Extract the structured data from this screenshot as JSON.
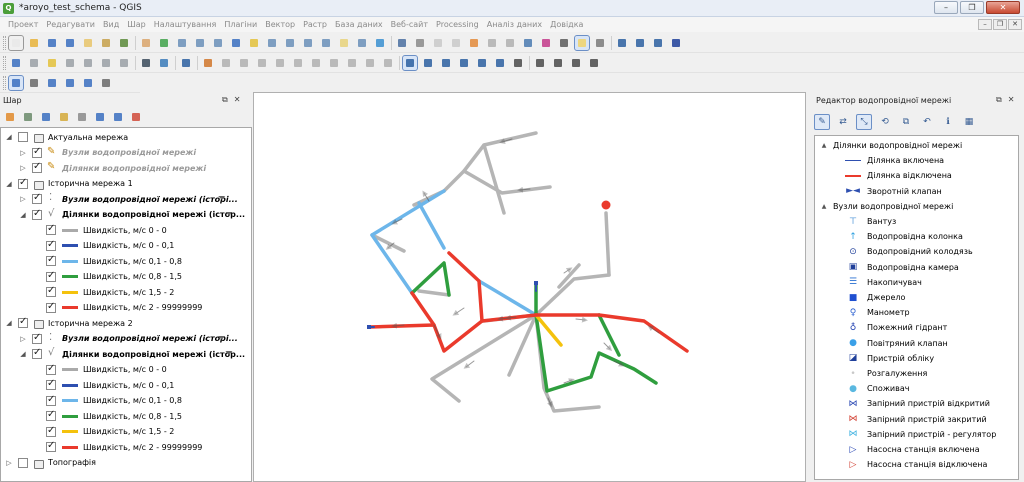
{
  "window": {
    "title": "*aroyo_test_schema - QGIS",
    "logo_glyph": "Q",
    "controls": [
      "–",
      "❐",
      "✕"
    ]
  },
  "menu": {
    "items": [
      "Проект",
      "Редагувати",
      "Вид",
      "Шар",
      "Налаштування",
      "Плагіни",
      "Вектор",
      "Растр",
      "База даних",
      "Веб-сайт",
      "Processing",
      "Аналіз даних",
      "Довідка"
    ]
  },
  "mdi_controls": [
    "–",
    "❐",
    "✕"
  ],
  "layers_panel": {
    "title": "Шар",
    "dock_icons": [
      "⧉",
      "✕"
    ],
    "rows": [
      {
        "label": "Актуальна мережа",
        "type": "group",
        "checked": false,
        "expanded": true,
        "indent": 0,
        "style": ""
      },
      {
        "label": "Вузли водопровідної мережі",
        "type": "edit",
        "checked": true,
        "expanded": false,
        "indent": 1,
        "style": "grey bold italic"
      },
      {
        "label": "Ділянки водопровідної мережі",
        "type": "edit",
        "checked": true,
        "expanded": false,
        "indent": 1,
        "style": "grey bold italic"
      },
      {
        "label": "Історична мережа 1",
        "type": "group",
        "checked": true,
        "expanded": true,
        "indent": 0,
        "style": ""
      },
      {
        "label": "Вузли водопровідної мережі (історі...",
        "type": "pts",
        "checked": true,
        "expanded": false,
        "indent": 1,
        "style": "bold italic",
        "filter": true
      },
      {
        "label": "Ділянки водопровідної мережі (істор...",
        "type": "line",
        "checked": true,
        "expanded": true,
        "indent": 1,
        "style": "bold",
        "filter": true
      },
      {
        "label": "Швидкість, м/с 0 - 0",
        "type": "legend",
        "checked": true,
        "color": "#aaaaaa",
        "indent": 2
      },
      {
        "label": "Швидкість, м/с 0 - 0,1",
        "type": "legend",
        "checked": true,
        "color": "#2e4fb0",
        "indent": 2
      },
      {
        "label": "Швидкість, м/с 0,1 - 0,8",
        "type": "legend",
        "checked": true,
        "color": "#6db6ea",
        "indent": 2
      },
      {
        "label": "Швидкість, м/с 0,8 - 1,5",
        "type": "legend",
        "checked": true,
        "color": "#2f9e3e",
        "indent": 2
      },
      {
        "label": "Швидкість, м/с 1,5 - 2",
        "type": "legend",
        "checked": true,
        "color": "#f4c20d",
        "indent": 2
      },
      {
        "label": "Швидкість, м/с 2 - 99999999",
        "type": "legend",
        "checked": true,
        "color": "#ea3a2c",
        "indent": 2
      },
      {
        "label": "Історична мережа 2",
        "type": "group",
        "checked": true,
        "expanded": true,
        "indent": 0,
        "style": ""
      },
      {
        "label": "Вузли водопровідної мережі (історі...",
        "type": "pts",
        "checked": true,
        "expanded": false,
        "indent": 1,
        "style": "bold italic",
        "filter": true
      },
      {
        "label": "Ділянки водопровідної мережі (істор...",
        "type": "line",
        "checked": true,
        "expanded": true,
        "indent": 1,
        "style": "bold",
        "filter": true
      },
      {
        "label": "Швидкість, м/с 0 - 0",
        "type": "legend",
        "checked": true,
        "color": "#aaaaaa",
        "indent": 2
      },
      {
        "label": "Швидкість, м/с 0 - 0,1",
        "type": "legend",
        "checked": true,
        "color": "#2e4fb0",
        "indent": 2
      },
      {
        "label": "Швидкість, м/с 0,1 - 0,8",
        "type": "legend",
        "checked": true,
        "color": "#6db6ea",
        "indent": 2
      },
      {
        "label": "Швидкість, м/с 0,8 - 1,5",
        "type": "legend",
        "checked": true,
        "color": "#2f9e3e",
        "indent": 2
      },
      {
        "label": "Швидкість, м/с 1,5 - 2",
        "type": "legend",
        "checked": true,
        "color": "#f4c20d",
        "indent": 2
      },
      {
        "label": "Швидкість, м/с 2 - 99999999",
        "type": "legend",
        "checked": true,
        "color": "#ea3a2c",
        "indent": 2
      },
      {
        "label": "Топографія",
        "type": "group",
        "checked": false,
        "expanded": false,
        "indent": 0,
        "style": ""
      }
    ]
  },
  "editor_panel": {
    "title": "Редактор водопровідної мережі",
    "dock_icons": [
      "⧉",
      "✕"
    ],
    "tools": [
      "✎",
      "⇄",
      "⤡",
      "⟲",
      "⧉",
      "↶",
      "ℹ",
      "▦"
    ],
    "rows": [
      {
        "label": "Ділянки водопровідної мережі",
        "kind": "header",
        "sym": "▲"
      },
      {
        "label": "Ділянка включена",
        "kind": "item",
        "sym": "line",
        "color": "#2e4fb0"
      },
      {
        "label": "Ділянка відключена",
        "kind": "item",
        "sym": "line",
        "color": "#ea3a2c"
      },
      {
        "label": "Зворотній клапан",
        "kind": "item",
        "sym": "►◄",
        "color": "#2e4fb0"
      },
      {
        "label": "Вузли водопровідної мережі",
        "kind": "header",
        "sym": "▲"
      },
      {
        "label": "Вантуз",
        "kind": "item",
        "sym": "⊤",
        "color": "#2a7fd0"
      },
      {
        "label": "Водопровідна колонка",
        "kind": "item",
        "sym": "↑",
        "color": "#2a9fe0"
      },
      {
        "label": "Водопровідний колодязь",
        "kind": "item",
        "sym": "⊙",
        "color": "#1f3f9a"
      },
      {
        "label": "Водопровідна камера",
        "kind": "item",
        "sym": "▣",
        "color": "#1f3f9a"
      },
      {
        "label": "Накопичувач",
        "kind": "item",
        "sym": "☰",
        "color": "#2a6fd0"
      },
      {
        "label": "Джерело",
        "kind": "item",
        "sym": "■",
        "color": "#1f4fd0"
      },
      {
        "label": "Манометр",
        "kind": "item",
        "sym": "♀",
        "color": "#2a5fd0"
      },
      {
        "label": "Пожежний гідрант",
        "kind": "item",
        "sym": "♁",
        "color": "#1f3fb0"
      },
      {
        "label": "Повітряний клапан",
        "kind": "item",
        "sym": "●",
        "color": "#3aa0e8"
      },
      {
        "label": "Пристрій обліку",
        "kind": "item",
        "sym": "◪",
        "color": "#1f3f9a"
      },
      {
        "label": "Розгалуження",
        "kind": "item",
        "sym": "•",
        "color": "#c8c8c8"
      },
      {
        "label": "Споживач",
        "kind": "item",
        "sym": "●",
        "color": "#5ab8e0"
      },
      {
        "label": "Запірний пристрій відкритий",
        "kind": "item",
        "sym": "⋈",
        "color": "#1f3fb0"
      },
      {
        "label": "Запірний пристрій закритий",
        "kind": "item",
        "sym": "⋈",
        "color": "#d03a2c"
      },
      {
        "label": "Запірний пристрій - регулятор",
        "kind": "item",
        "sym": "⋈",
        "color": "#3ab0e0"
      },
      {
        "label": "Насосна станція включена",
        "kind": "item",
        "sym": "▷",
        "color": "#1f3fb0"
      },
      {
        "label": "Насосна станція відключена",
        "kind": "item",
        "sym": "▷",
        "color": "#d03a2c"
      }
    ]
  },
  "colors": {
    "grey": "#aaaaaa",
    "dark_blue": "#2e4fb0",
    "light_blue": "#6db6ea",
    "green": "#2f9e3e",
    "yellow": "#f4c20d",
    "red": "#ea3a2c"
  }
}
